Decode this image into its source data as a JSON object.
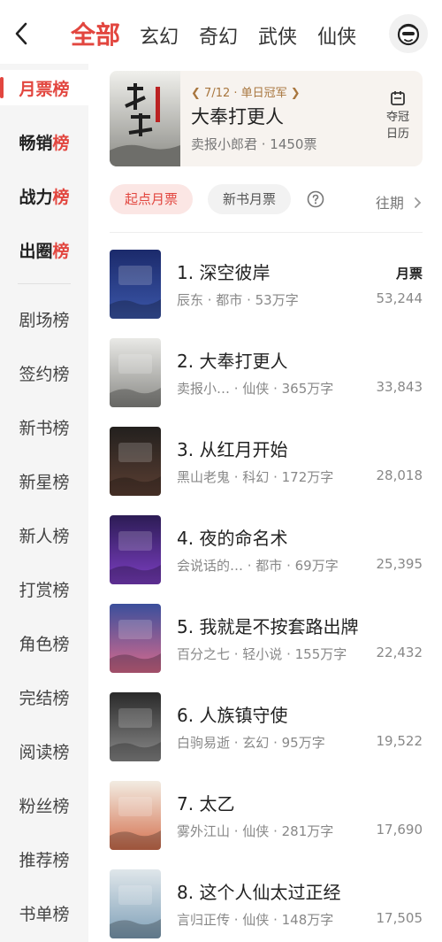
{
  "header": {
    "tabs": [
      "全部",
      "玄幻",
      "奇幻",
      "武侠",
      "仙侠"
    ]
  },
  "sidebar": {
    "selected": "月票榜",
    "top_items": [
      {
        "label": "月票榜"
      },
      {
        "pre": "畅销",
        "hot": "榜"
      },
      {
        "pre": "战力",
        "hot": "榜"
      },
      {
        "pre": "出圈",
        "hot": "榜"
      }
    ],
    "items": [
      "剧场榜",
      "签约榜",
      "新书榜",
      "新星榜",
      "新人榜",
      "打赏榜",
      "角色榜",
      "完结榜",
      "阅读榜",
      "粉丝榜",
      "推荐榜",
      "书单榜"
    ]
  },
  "champion": {
    "badge": "7/12 · 单日冠军",
    "title": "大奉打更人",
    "meta": "卖报小郎君 · 1450票",
    "calendar_label_1": "夺冠",
    "calendar_label_2": "日历"
  },
  "filters": {
    "active": "起点月票",
    "other": "新书月票",
    "period": "往期"
  },
  "count_label": "月票",
  "books": [
    {
      "rank": "1. 深空彼岸",
      "meta": "辰东 · 都市 · 53万字",
      "count": "53,244",
      "colors": [
        "#1b2a6b",
        "#3b56a8"
      ]
    },
    {
      "rank": "2. 大奉打更人",
      "meta": "卖报小… · 仙侠 · 365万字",
      "count": "33,843",
      "colors": [
        "#e9e9e6",
        "#8a8a86"
      ]
    },
    {
      "rank": "3. 从红月开始",
      "meta": "黑山老鬼 · 科幻 · 172万字",
      "count": "28,018",
      "colors": [
        "#23201e",
        "#5a3e32"
      ]
    },
    {
      "rank": "4. 夜的命名术",
      "meta": "会说话的… · 都市 · 69万字",
      "count": "25,395",
      "colors": [
        "#2c1c55",
        "#7c3ec2"
      ]
    },
    {
      "rank": "5. 我就是不按套路出牌",
      "meta": "百分之七 · 轻小说 · 155万字",
      "count": "22,432",
      "colors": [
        "#3b4f9c",
        "#d86a8c"
      ]
    },
    {
      "rank": "6. 人族镇守使",
      "meta": "白驹易逝 · 玄幻 · 95万字",
      "count": "19,522",
      "colors": [
        "#2a2a2a",
        "#8a8a8a"
      ]
    },
    {
      "rank": "7. 太乙",
      "meta": "雾外江山 · 仙侠 · 281万字",
      "count": "17,690",
      "colors": [
        "#f2ece2",
        "#d4714f"
      ]
    },
    {
      "rank": "8. 这个人仙太过正经",
      "meta": "言归正传 · 仙侠 · 148万字",
      "count": "17,505",
      "colors": [
        "#dfe6ea",
        "#7fa0b8"
      ]
    }
  ]
}
